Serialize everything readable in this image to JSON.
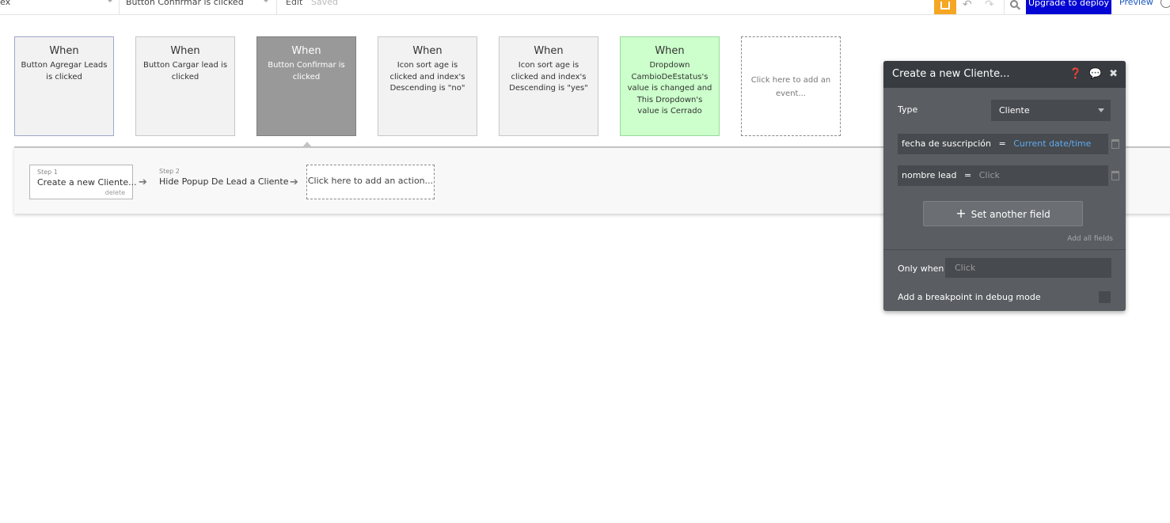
{
  "topbar": {
    "page_select": "ex",
    "event_select": "Button Confirmar is clicked",
    "edit": "Edit",
    "saved": "Saved",
    "upgrade": "Upgrade to deploy",
    "preview": "Preview"
  },
  "events": [
    {
      "when": "When",
      "desc": "Button Agregar Leads is clicked"
    },
    {
      "when": "When",
      "desc": "Button Cargar lead is clicked"
    },
    {
      "when": "When",
      "desc": "Button Confirmar is clicked"
    },
    {
      "when": "When",
      "desc": "Icon sort age is clicked and index's Descending is \"no\""
    },
    {
      "when": "When",
      "desc": "Icon sort age is clicked and index's Descending is \"yes\""
    },
    {
      "when": "When",
      "desc": "Dropdown CambioDeEstatus's value is changed and This Dropdown's value is Cerrado"
    }
  ],
  "add_event": "Click here to add an event...",
  "actions": {
    "step1": {
      "num": "Step 1",
      "title": "Create a new Cliente...",
      "delete": "delete"
    },
    "step2": {
      "num": "Step 2",
      "title": "Hide Popup De Lead a Cliente"
    },
    "add_action": "Click here to add an action..."
  },
  "editor": {
    "title": "Create a new Cliente...",
    "icons": [
      "help-icon",
      "comment-icon",
      "close-icon"
    ],
    "type_label": "Type",
    "type_value": "Cliente",
    "fields": [
      {
        "name": "fecha de suscripción",
        "eq": "=",
        "value": "Current date/time"
      },
      {
        "name": "nombre lead",
        "eq": "=",
        "value": "Click"
      }
    ],
    "set_another": "Set another field",
    "add_all": "Add all fields",
    "only_when_label": "Only when",
    "only_when_value": "Click",
    "breakpoint_label": "Add a breakpoint in debug mode"
  },
  "colors": {
    "upgrade_bg": "#0205d3",
    "home_btn": "#f5a623",
    "active_card": "#999999",
    "green_card": "#ccffcc",
    "editor_bg": "#5a5d61",
    "editor_header": "#383c40",
    "link_blue": "#5dabf0"
  }
}
